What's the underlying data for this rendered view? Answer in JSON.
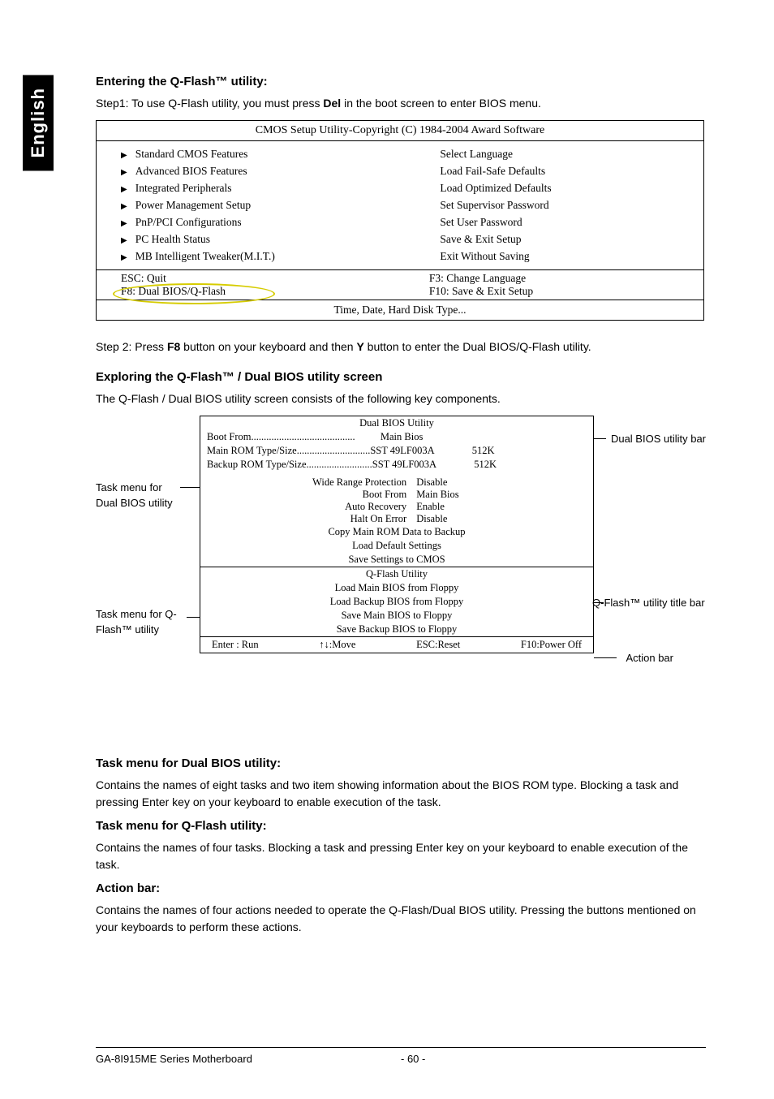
{
  "side_tab": "English",
  "sections": {
    "enter_title": "Entering the Q-Flash™ utility:",
    "step1_pre": "Step1: To use Q-Flash utility, you must press ",
    "step1_bold": "Del",
    "step1_post": " in the boot screen to enter BIOS menu.",
    "step2_pre": "Step 2: Press ",
    "step2_b1": "F8",
    "step2_mid": " button on your keyboard and then ",
    "step2_b2": "Y",
    "step2_post": " button to enter the Dual BIOS/Q-Flash utility.",
    "explore_title": "Exploring the Q-Flash™ / Dual BIOS utility screen",
    "explore_para": "The Q-Flash / Dual BIOS utility screen consists of the following key components.",
    "task_dual_title": "Task menu for Dual BIOS utility:",
    "task_dual_para": "Contains the names of eight tasks and two item showing information about the BIOS ROM type. Blocking a task and pressing Enter key on your keyboard to enable execution of the task.",
    "task_qf_title": "Task menu for Q-Flash utility:",
    "task_qf_para": "Contains the names of four tasks. Blocking a task and pressing Enter key on your keyboard to enable execution of the task.",
    "action_title": "Action bar:",
    "action_para": "Contains the names of four actions needed to operate the Q-Flash/Dual BIOS utility. Pressing the buttons mentioned on your keyboards to perform these actions."
  },
  "bios": {
    "title": "CMOS Setup Utility-Copyright (C) 1984-2004 Award Software",
    "left": [
      "Standard CMOS Features",
      "Advanced BIOS Features",
      "Integrated Peripherals",
      "Power Management Setup",
      "PnP/PCI Configurations",
      "PC Health Status",
      "MB Intelligent Tweaker(M.I.T.)"
    ],
    "right": [
      "Select Language",
      "Load Fail-Safe Defaults",
      "Load Optimized Defaults",
      "Set Supervisor Password",
      "Set User Password",
      "Save & Exit Setup",
      "Exit Without Saving"
    ],
    "keys_left": [
      "ESC: Quit",
      "F8: Dual BIOS/Q-Flash"
    ],
    "keys_right": [
      "F3: Change Language",
      "F10: Save & Exit Setup"
    ],
    "foot": "Time, Date, Hard Disk Type..."
  },
  "qf": {
    "title_dual": "Dual BIOS Utility",
    "boot_from_line": "Boot From.........................................          Main Bios",
    "main_rom_line": "Main ROM Type/Size.............................SST 49LF003A               512K",
    "backup_rom_line": "Backup ROM Type/Size..........................SST 49LF003A               512K",
    "settings": [
      {
        "label": "Wide Range Protection",
        "value": "Disable"
      },
      {
        "label": "Boot From",
        "value": "Main Bios"
      },
      {
        "label": "Auto Recovery",
        "value": "Enable"
      },
      {
        "label": "Halt On Error",
        "value": "Disable"
      }
    ],
    "tasks_dual": [
      "Copy Main ROM Data to Backup",
      "Load Default Settings",
      "Save Settings to CMOS"
    ],
    "title_qf": "Q-Flash Utility",
    "tasks_qf": [
      "Load Main BIOS from Floppy",
      "Load Backup BIOS from Floppy",
      "Save Main BIOS to Floppy",
      "Save Backup BIOS to Floppy"
    ],
    "actions": {
      "enter": "Enter : Run",
      "move": "↑↓:Move",
      "esc": "ESC:Reset",
      "f10": "F10:Power Off"
    }
  },
  "callouts": {
    "dual_bar": "Dual BIOS utility bar",
    "task_dual": "Task menu for Dual BIOS utility",
    "task_qf": "Task menu for Q-Flash™ utility",
    "qf_bar": "Q-Flash™ utility title bar",
    "action_bar": "Action bar"
  },
  "footer": {
    "left": "GA-8I915ME Series Motherboard",
    "right": "- 60 -"
  }
}
